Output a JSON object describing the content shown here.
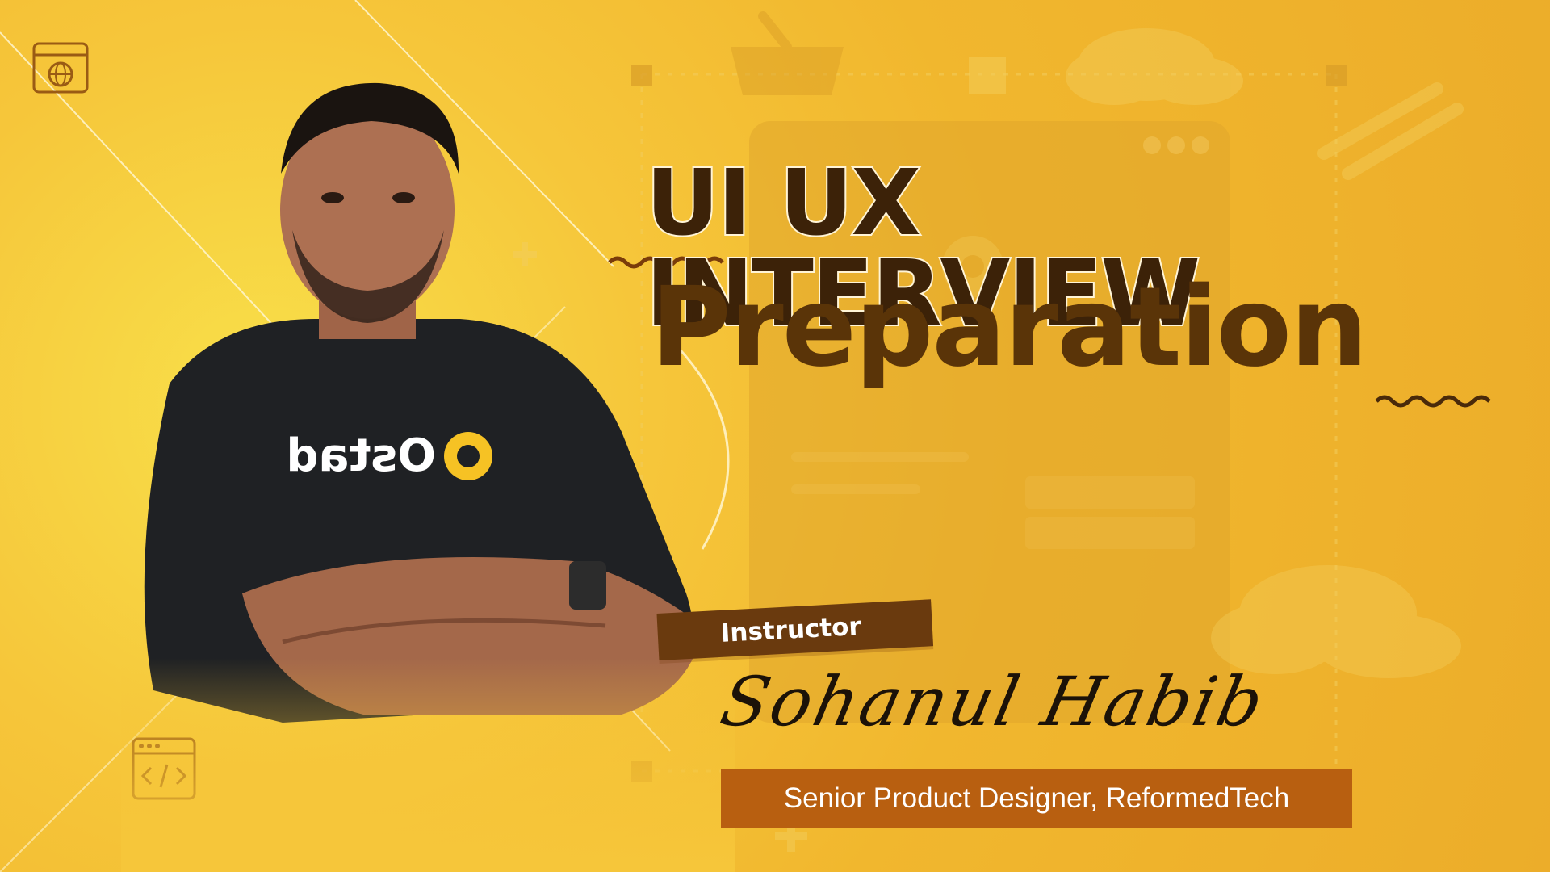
{
  "title": {
    "line1": "UI UX INTERVIEW",
    "line2": "Preparation"
  },
  "instructor": {
    "tag": "Instructor",
    "name": "Sohanul Habib",
    "role": "Senior Product Designer, ReformedTech"
  },
  "shirt_logo_text": "Ostad",
  "colors": {
    "background": "#f1b72e",
    "title_dark": "#3c2208",
    "accent_brown": "#6a3a0e",
    "role_bar": "#b85f10"
  },
  "icons": [
    "browser-globe-icon",
    "code-window-icon",
    "basket-icon",
    "cloud-icon",
    "gear-icon"
  ]
}
